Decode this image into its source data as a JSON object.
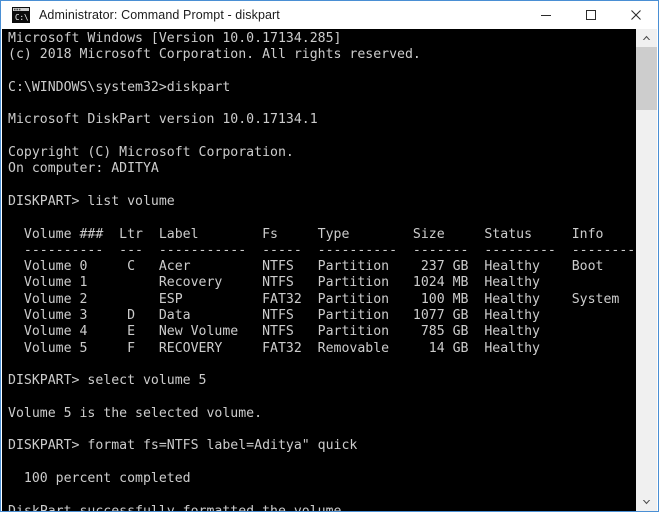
{
  "window": {
    "title": "Administrator: Command Prompt - diskpart",
    "icon": "command-prompt-icon",
    "accent_border_color": "#4a8fd4",
    "titlebar_bg": "#ffffff",
    "console_bg": "#000000",
    "console_fg": "#cccccc",
    "controls": {
      "minimize_label": "Minimize",
      "maximize_label": "Maximize",
      "close_label": "Close"
    }
  },
  "scrollbar": {
    "up_arrow": "▲",
    "down_arrow": "▼",
    "thumb_color": "#cdcdcd",
    "track_color": "#f0f0f0"
  },
  "console": {
    "lines": [
      "Microsoft Windows [Version 10.0.17134.285]",
      "(c) 2018 Microsoft Corporation. All rights reserved.",
      "",
      "C:\\WINDOWS\\system32>diskpart",
      "",
      "Microsoft DiskPart version 10.0.17134.1",
      "",
      "Copyright (C) Microsoft Corporation.",
      "On computer: ADITYA",
      "",
      "DISKPART> list volume",
      "",
      "  Volume ###  Ltr  Label        Fs     Type        Size     Status     Info",
      "  ----------  ---  -----------  -----  ----------  -------  ---------  --------",
      "  Volume 0     C   Acer         NTFS   Partition    237 GB  Healthy    Boot",
      "  Volume 1         Recovery     NTFS   Partition   1024 MB  Healthy",
      "  Volume 2         ESP          FAT32  Partition    100 MB  Healthy    System",
      "  Volume 3     D   Data         NTFS   Partition   1077 GB  Healthy",
      "  Volume 4     E   New Volume   NTFS   Partition    785 GB  Healthy",
      "  Volume 5     F   RECOVERY     FAT32  Removable     14 GB  Healthy",
      "",
      "DISKPART> select volume 5",
      "",
      "Volume 5 is the selected volume.",
      "",
      "DISKPART> format fs=NTFS label=Aditya\" quick",
      "",
      "  100 percent completed",
      "",
      "DiskPart successfully formatted the volume."
    ],
    "volume_table": {
      "headers": [
        "Volume ###",
        "Ltr",
        "Label",
        "Fs",
        "Type",
        "Size",
        "Status",
        "Info"
      ],
      "rows": [
        [
          "Volume 0",
          "C",
          "Acer",
          "NTFS",
          "Partition",
          "237 GB",
          "Healthy",
          "Boot"
        ],
        [
          "Volume 1",
          "",
          "Recovery",
          "NTFS",
          "Partition",
          "1024 MB",
          "Healthy",
          ""
        ],
        [
          "Volume 2",
          "",
          "ESP",
          "FAT32",
          "Partition",
          "100 MB",
          "Healthy",
          "System"
        ],
        [
          "Volume 3",
          "D",
          "Data",
          "NTFS",
          "Partition",
          "1077 GB",
          "Healthy",
          ""
        ],
        [
          "Volume 4",
          "E",
          "New Volume",
          "NTFS",
          "Partition",
          "785 GB",
          "Healthy",
          ""
        ],
        [
          "Volume 5",
          "F",
          "RECOVERY",
          "FAT32",
          "Removable",
          "14 GB",
          "Healthy",
          ""
        ]
      ]
    },
    "commands": [
      "diskpart",
      "list volume",
      "select volume 5",
      "format fs=NTFS label=Aditya\" quick"
    ],
    "prompt_label": "DISKPART>",
    "shell_prompt": "C:\\WINDOWS\\system32>",
    "status_messages": [
      "Volume 5 is the selected volume.",
      "100 percent completed",
      "DiskPart successfully formatted the volume."
    ]
  }
}
